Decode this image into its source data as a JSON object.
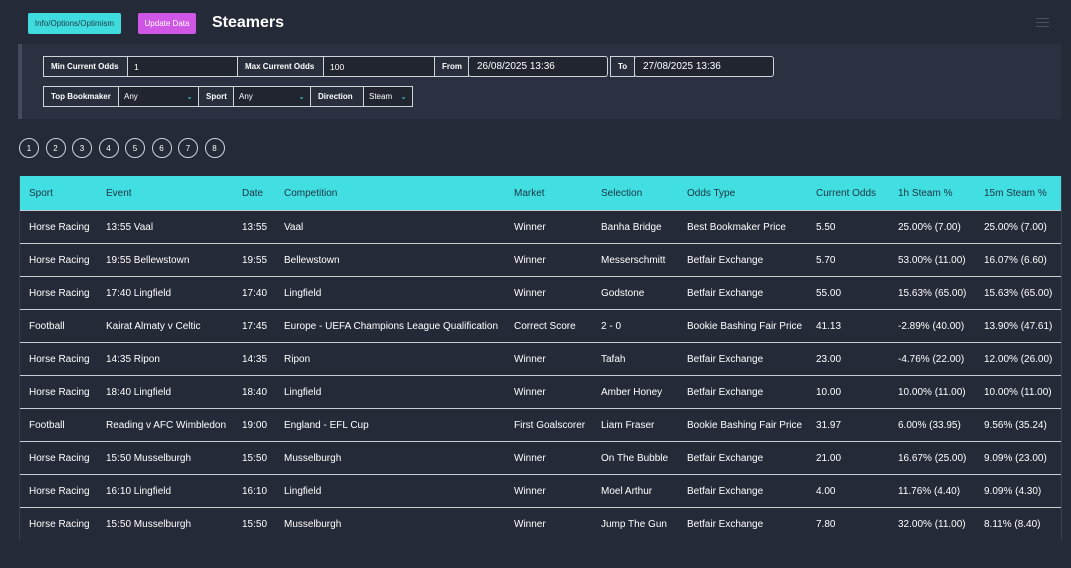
{
  "header": {
    "info_button": "Info/Options/Optimism",
    "update_button": "Update Data",
    "title": "Steamers"
  },
  "filters": {
    "min_odds_label": "Min Current Odds",
    "min_odds_value": "1",
    "max_odds_label": "Max Current Odds",
    "max_odds_value": "100",
    "from_label": "From",
    "from_value": "26/08/2025 13:36",
    "to_label": "To",
    "to_value": "27/08/2025 13:36",
    "top_bookmaker_label": "Top Bookmaker",
    "top_bookmaker_value": "Any",
    "sport_label": "Sport",
    "sport_value": "Any",
    "direction_label": "Direction",
    "direction_value": "Steam"
  },
  "pagination": [
    "1",
    "2",
    "3",
    "4",
    "5",
    "6",
    "7",
    "8"
  ],
  "table": {
    "headers": [
      "Sport",
      "Event",
      "Date",
      "Competition",
      "Market",
      "Selection",
      "Odds Type",
      "Current Odds",
      "1h Steam %",
      "15m Steam %"
    ],
    "rows": [
      [
        "Horse Racing",
        "13:55 Vaal",
        "13:55",
        "Vaal",
        "Winner",
        "Banha Bridge",
        "Best Bookmaker Price",
        "5.50",
        "25.00% (7.00)",
        "25.00% (7.00)"
      ],
      [
        "Horse Racing",
        "19:55 Bellewstown",
        "19:55",
        "Bellewstown",
        "Winner",
        "Messerschmitt",
        "Betfair Exchange",
        "5.70",
        "53.00% (11.00)",
        "16.07% (6.60)"
      ],
      [
        "Horse Racing",
        "17:40 Lingfield",
        "17:40",
        "Lingfield",
        "Winner",
        "Godstone",
        "Betfair Exchange",
        "55.00",
        "15.63% (65.00)",
        "15.63% (65.00)"
      ],
      [
        "Football",
        "Kairat Almaty v Celtic",
        "17:45",
        "Europe - UEFA Champions League Qualification",
        "Correct Score",
        "2 - 0",
        "Bookie Bashing Fair Price",
        "41.13",
        "-2.89% (40.00)",
        "13.90% (47.61)"
      ],
      [
        "Horse Racing",
        "14:35 Ripon",
        "14:35",
        "Ripon",
        "Winner",
        "Tafah",
        "Betfair Exchange",
        "23.00",
        "-4.76% (22.00)",
        "12.00% (26.00)"
      ],
      [
        "Horse Racing",
        "18:40 Lingfield",
        "18:40",
        "Lingfield",
        "Winner",
        "Amber Honey",
        "Betfair Exchange",
        "10.00",
        "10.00% (11.00)",
        "10.00% (11.00)"
      ],
      [
        "Football",
        "Reading v AFC Wimbledon",
        "19:00",
        "England - EFL Cup",
        "First Goalscorer",
        "Liam Fraser",
        "Bookie Bashing Fair Price",
        "31.97",
        "6.00% (33.95)",
        "9.56% (35.24)"
      ],
      [
        "Horse Racing",
        "15:50 Musselburgh",
        "15:50",
        "Musselburgh",
        "Winner",
        "On The Bubble",
        "Betfair Exchange",
        "21.00",
        "16.67% (25.00)",
        "9.09% (23.00)"
      ],
      [
        "Horse Racing",
        "16:10 Lingfield",
        "16:10",
        "Lingfield",
        "Winner",
        "Moel Arthur",
        "Betfair Exchange",
        "4.00",
        "11.76% (4.40)",
        "9.09% (4.30)"
      ],
      [
        "Horse Racing",
        "15:50 Musselburgh",
        "15:50",
        "Musselburgh",
        "Winner",
        "Jump The Gun",
        "Betfair Exchange",
        "7.80",
        "32.00% (11.00)",
        "8.11% (8.40)"
      ]
    ]
  }
}
